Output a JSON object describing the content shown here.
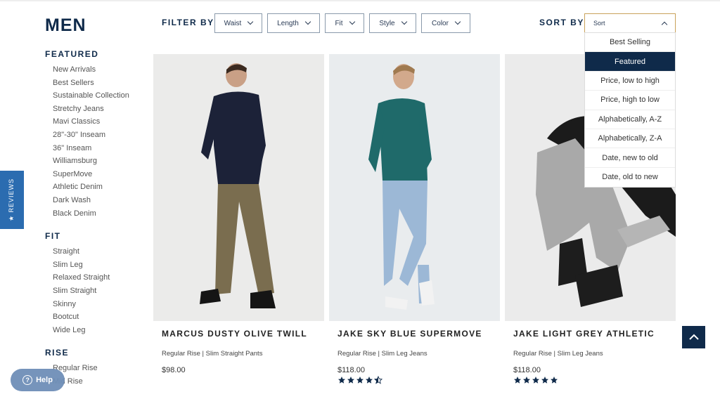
{
  "page": {
    "title": "MEN"
  },
  "sidebar": {
    "sections": [
      {
        "heading": "FEATURED",
        "items": [
          "New Arrivals",
          "Best Sellers",
          "Sustainable Collection",
          "Stretchy Jeans",
          "Mavi Classics",
          "28\"-30\" Inseam",
          "36\" Inseam",
          "Williamsburg",
          "SuperMove",
          "Athletic Denim",
          "Dark Wash",
          "Black Denim"
        ]
      },
      {
        "heading": "FIT",
        "items": [
          "Straight",
          "Slim Leg",
          "Relaxed Straight",
          "Slim Straight",
          "Skinny",
          "Bootcut",
          "Wide Leg"
        ]
      },
      {
        "heading": "RISE",
        "items": [
          "Regular Rise",
          "Mid Rise"
        ]
      }
    ]
  },
  "filter": {
    "label": "FILTER BY",
    "buttons": [
      "Waist",
      "Length",
      "Fit",
      "Style",
      "Color"
    ]
  },
  "sort": {
    "label": "SORT BY",
    "placeholder": "Sort",
    "options": [
      "Best Selling",
      "Featured",
      "Price, low to high",
      "Price, high to low",
      "Alphabetically, A-Z",
      "Alphabetically, Z-A",
      "Date, new to old",
      "Date, old to new"
    ],
    "selected": "Featured"
  },
  "products": [
    {
      "name": "MARCUS DUSTY OLIVE TWILL",
      "subtitle": "Regular Rise | Slim Straight Pants",
      "price": "$98.00",
      "rating": null
    },
    {
      "name": "JAKE SKY BLUE SUPERMOVE",
      "subtitle": "Regular Rise | Slim Leg Jeans",
      "price": "$118.00",
      "rating": 4.5
    },
    {
      "name": "JAKE LIGHT GREY ATHLETIC",
      "subtitle": "Regular Rise | Slim Leg Jeans",
      "price": "$118.00",
      "rating": 5
    }
  ],
  "reviews_tab": {
    "label": "★ REVIEWS"
  },
  "help": {
    "label": "Help"
  },
  "colors": {
    "navy": "#0f2a4a",
    "reviews_blue": "#2b6cb0",
    "help_blue": "#6f8fb8",
    "sort_border": "#c9a25a"
  },
  "icons": [
    "chevron-down-icon",
    "chevron-up-icon",
    "star-icon",
    "help-icon",
    "arrow-up-icon"
  ]
}
